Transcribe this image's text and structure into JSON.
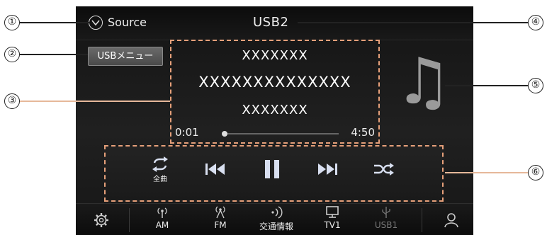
{
  "callouts": [
    "①",
    "②",
    "③",
    "④",
    "⑤",
    "⑥"
  ],
  "header": {
    "source_label": "Source",
    "title": "USB2"
  },
  "usb_menu_label": "USBメニュー",
  "track_info": {
    "line1": "XXXXXXX",
    "line2": "XXXXXXXXXXXXXX",
    "line3": "XXXXXXX"
  },
  "playback": {
    "elapsed": "0:01",
    "total": "4:50",
    "progress": 0.01
  },
  "controls": {
    "repeat_label": "全曲"
  },
  "nav": {
    "am": "AM",
    "fm": "FM",
    "traffic": "交通情報",
    "tv1": "TV1",
    "usb1": "USB1"
  },
  "icons": [
    "chevron-circle-icon",
    "music-note-icon",
    "repeat-icon",
    "previous-icon",
    "pause-icon",
    "next-icon",
    "shuffle-icon",
    "gear-icon",
    "antenna-icon",
    "traffic-info-icon",
    "tv-icon",
    "usb-icon",
    "user-icon"
  ],
  "colors": {
    "highlight_dashed": "#e6a07a",
    "background": "#1a1a1a",
    "text": "#ffffff",
    "inactive": "#777777"
  }
}
